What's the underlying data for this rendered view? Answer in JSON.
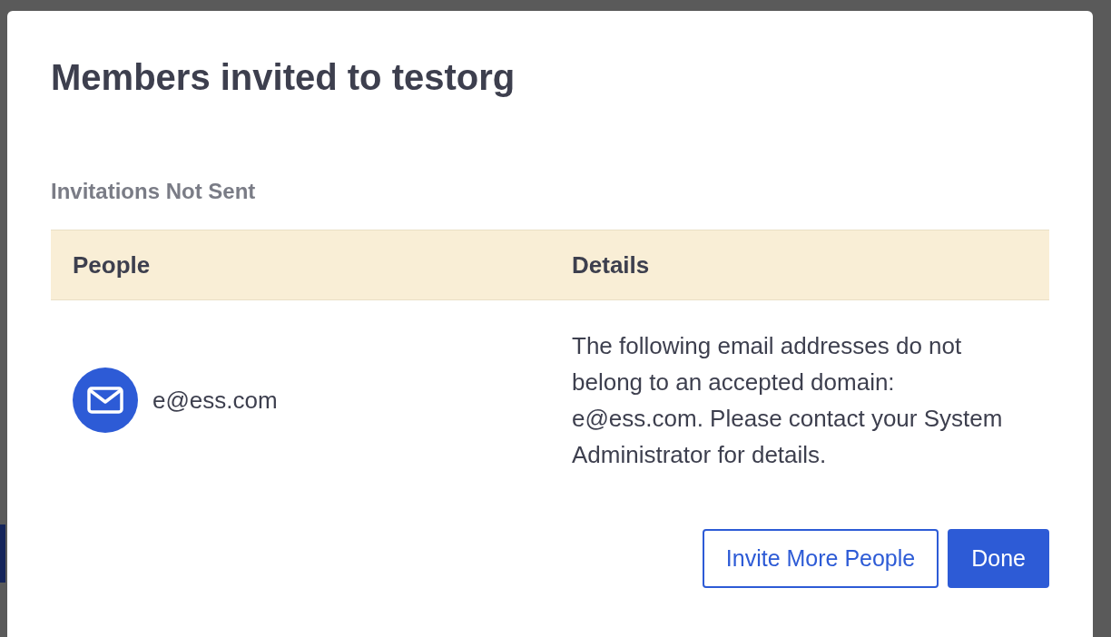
{
  "dialog": {
    "title": "Members invited to testorg",
    "section_title": "Invitations Not Sent",
    "table": {
      "columns": [
        "People",
        "Details"
      ],
      "rows": [
        {
          "email": "e@ess.com",
          "details": "The following email addresses do not belong to an accepted domain: e@ess.com. Please contact your System Administrator for details."
        }
      ]
    },
    "buttons": [
      {
        "label": "Invite More People",
        "kind": "secondary"
      },
      {
        "label": "Done",
        "kind": "primary"
      }
    ]
  }
}
